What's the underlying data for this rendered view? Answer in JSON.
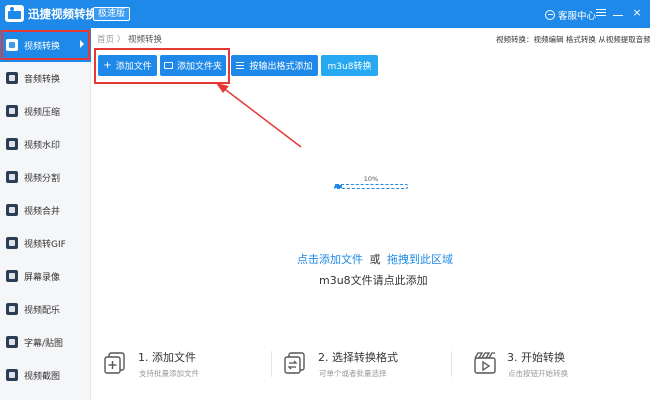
{
  "titlebar": {
    "app_title": "迅捷视频转换器",
    "badge": "极速版",
    "service": "客服中心",
    "close": "×"
  },
  "sidebar": {
    "items": [
      {
        "label": "视频转换",
        "icon": "video-convert-icon"
      },
      {
        "label": "音频转换",
        "icon": "audio-convert-icon"
      },
      {
        "label": "视频压缩",
        "icon": "video-compress-icon"
      },
      {
        "label": "视频水印",
        "icon": "video-watermark-icon"
      },
      {
        "label": "视频分割",
        "icon": "video-split-icon"
      },
      {
        "label": "视频合并",
        "icon": "video-merge-icon"
      },
      {
        "label": "视频转GIF",
        "icon": "video-gif-icon"
      },
      {
        "label": "屏幕录像",
        "icon": "screen-record-icon"
      },
      {
        "label": "视频配乐",
        "icon": "video-music-icon"
      },
      {
        "label": "字幕/贴图",
        "icon": "subtitle-icon"
      },
      {
        "label": "视频截图",
        "icon": "video-screenshot-icon"
      }
    ]
  },
  "breadcrumb": {
    "home": "首页",
    "separator": "〉",
    "current": "视频转换"
  },
  "hint_right": "视频转换：视频编辑 格式转换 从视频提取音频",
  "toolbar": {
    "add_file": "添加文件",
    "add_folder": "添加文件夹",
    "by_format": "按输出格式添加",
    "m3u8": "m3u8转换"
  },
  "progress": {
    "label": "10%",
    "value": 10
  },
  "dropzone": {
    "click_add": "点击添加文件",
    "or": "或",
    "drag": "拖拽到此区域",
    "m3u8_hint": "m3u8文件请点此添加"
  },
  "steps": [
    {
      "title": "1. 添加文件",
      "desc": "支持批量添加文件"
    },
    {
      "title": "2. 选择转换格式",
      "desc": "可单个或者批量选择"
    },
    {
      "title": "3. 开始转换",
      "desc": "点击按钮开始转换"
    }
  ],
  "colors": {
    "primary": "#1e89e8",
    "highlight": "#e53935"
  }
}
